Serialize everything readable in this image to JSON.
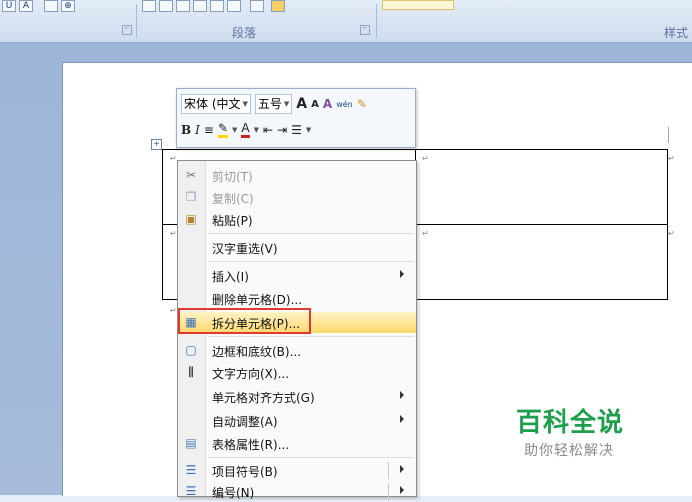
{
  "ribbon": {
    "paragraph_group_label": "段落",
    "styles_group_label": "样式",
    "dialog_launcher": "⌐",
    "toolbar_glyphs": [
      "U",
      "A",
      "⊕"
    ]
  },
  "mini_toolbar": {
    "font_name": "宋体 (中文",
    "font_size": "五号",
    "grow_font": "A",
    "shrink_font": "A",
    "phonetic": "wén",
    "bold": "B",
    "italic": "I",
    "center": "≡",
    "indent": "⇤",
    "outdent": "⇥",
    "bullets": "☰"
  },
  "context_menu": {
    "items": [
      {
        "label": "剪切(T)",
        "disabled": true
      },
      {
        "label": "复制(C)",
        "disabled": true
      },
      {
        "label": "粘贴(P)",
        "disabled": false
      },
      {
        "label": "汉字重选(V)",
        "disabled": false
      },
      {
        "label": "插入(I)",
        "disabled": false,
        "submenu": true
      },
      {
        "label": "删除单元格(D)...",
        "disabled": false
      },
      {
        "label": "拆分单元格(P)...",
        "disabled": false,
        "highlighted": true
      },
      {
        "label": "边框和底纹(B)...",
        "disabled": false
      },
      {
        "label": "文字方向(X)...",
        "disabled": false
      },
      {
        "label": "单元格对齐方式(G)",
        "disabled": false,
        "submenu": true
      },
      {
        "label": "自动调整(A)",
        "disabled": false,
        "submenu": true
      },
      {
        "label": "表格属性(R)...",
        "disabled": false
      },
      {
        "label": "项目符号(B)",
        "disabled": false,
        "submenu": true
      },
      {
        "label": "编号(N)",
        "disabled": false,
        "submenu": true
      }
    ]
  },
  "document": {
    "paragraph_mark": "↵",
    "table_move_handle": "+"
  },
  "watermark": {
    "title": "百科全说",
    "subtitle": "助你轻松解决"
  },
  "colors": {
    "highlight_outline": "#e03a2f",
    "watermark_green": "#1f9e4e",
    "menu_highlight": "#ffd86e"
  }
}
